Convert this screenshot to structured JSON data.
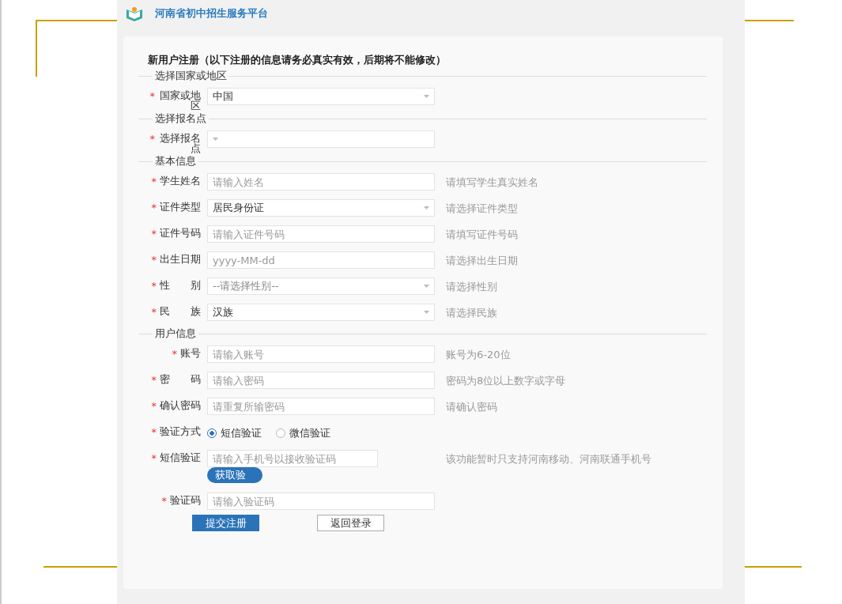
{
  "header": {
    "title": "河南省初中招生服务平台"
  },
  "form": {
    "title": "新用户注册（以下注册的信息请务必真实有效，后期将不能修改）",
    "sections": [
      {
        "legend": "选择国家或地区",
        "fields": [
          {
            "kind": "select",
            "label": "国家或地区",
            "mark": "*",
            "value": "中国"
          }
        ]
      },
      {
        "legend": "选择报名点",
        "fields": [
          {
            "kind": "select",
            "label": "选择报名点",
            "mark": "*"
          }
        ]
      },
      {
        "legend": "基本信息",
        "fields": [
          {
            "kind": "input",
            "label": "学生姓名",
            "mark": "*",
            "placeholder": "请输入姓名",
            "hint": "请填写学生真实姓名"
          },
          {
            "kind": "select",
            "label": "证件类型",
            "mark": "*",
            "value": "居民身份证",
            "hint": "请选择证件类型"
          },
          {
            "kind": "input",
            "label": "证件号码",
            "mark": "*",
            "placeholder": "请输入证件号码",
            "hint": "请填写证件号码"
          },
          {
            "kind": "input",
            "label": "出生日期",
            "mark": "*",
            "placeholder": "yyyy-MM-dd",
            "hint": "请选择出生日期"
          },
          {
            "kind": "select",
            "label": "性　　别",
            "mark": "*",
            "placeholder": "--请选择性别--",
            "hint": "请选择性别"
          },
          {
            "kind": "select",
            "label": "民　　族",
            "mark": "*",
            "value": "汉族",
            "hint": "请选择民族"
          }
        ]
      },
      {
        "legend": "用户信息",
        "fields": [
          {
            "kind": "input",
            "label": "账号",
            "mark": "*",
            "placeholder": "请输入账号",
            "hint": "账号为6-20位"
          },
          {
            "kind": "input",
            "label": "密　　码",
            "mark": "*",
            "placeholder": "请输入密码",
            "hint": "密码为8位以上数字或字母"
          },
          {
            "kind": "input",
            "label": "确认密码",
            "mark": "*",
            "placeholder": "请重复所输密码",
            "hint": "请确认密码"
          },
          {
            "kind": "radio",
            "label": "验证方式",
            "mark": "*",
            "options": [
              {
                "label": "短信验证",
                "selected": true
              },
              {
                "label": "微信验证",
                "selected": false
              }
            ]
          },
          {
            "kind": "sms",
            "label": "短信验证",
            "mark": "*",
            "placeholder": "请输入手机号以接收验证码",
            "button": "获取验",
            "hint": "该功能暂时只支持河南移动、河南联通手机号"
          },
          {
            "kind": "input",
            "label": "验证码",
            "mark": "*",
            "placeholder": "请输入验证码"
          }
        ]
      }
    ],
    "buttons": [
      {
        "label": "提交注册",
        "kind": "primary"
      },
      {
        "label": "返回登录",
        "kind": "secondary"
      }
    ]
  }
}
